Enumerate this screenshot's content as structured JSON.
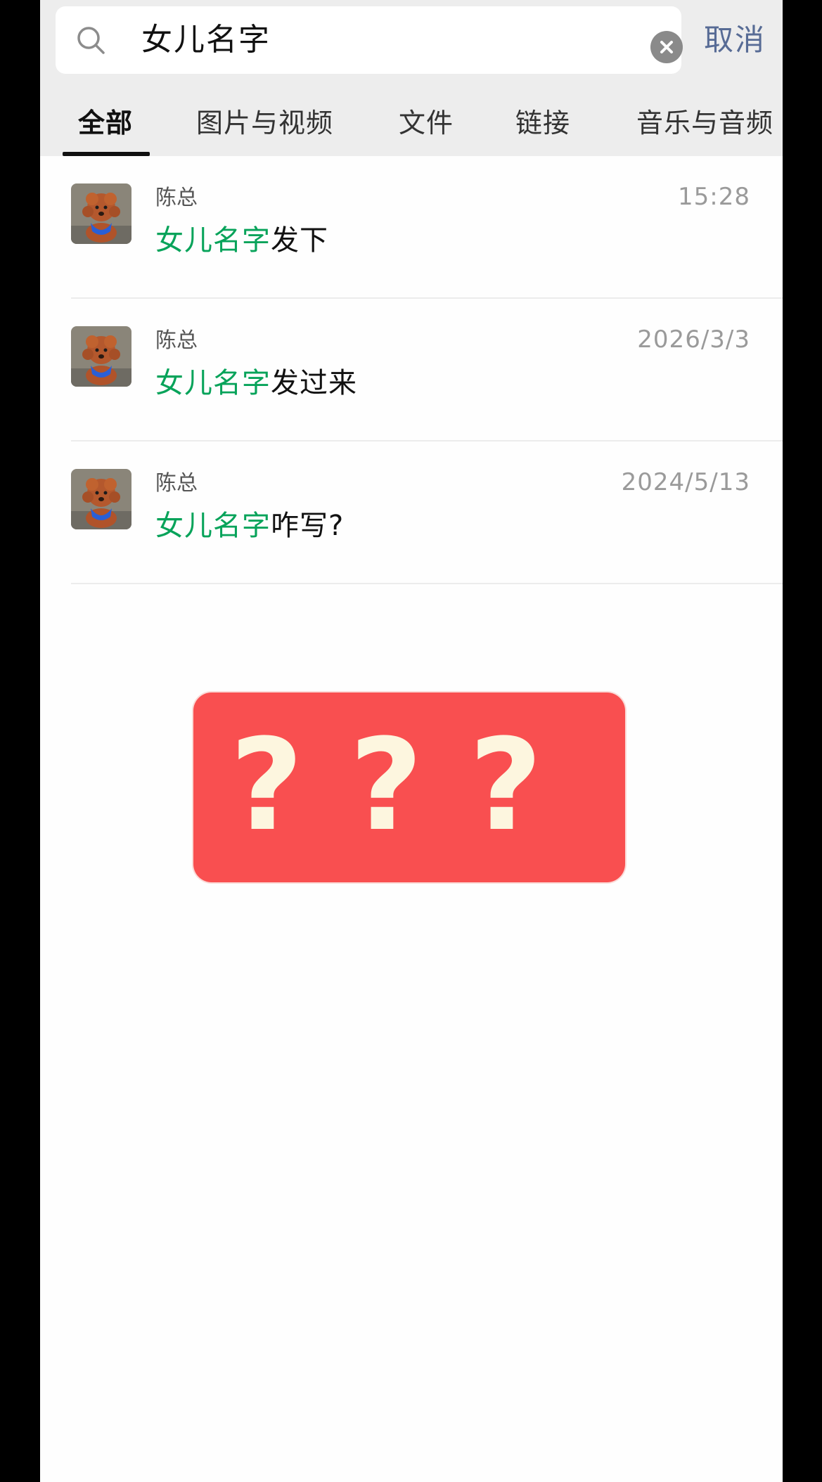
{
  "search": {
    "query": "女儿名字",
    "cancel_label": "取消"
  },
  "tabs": [
    {
      "label": "全部",
      "active": true
    },
    {
      "label": "图片与视频",
      "active": false
    },
    {
      "label": "文件",
      "active": false
    },
    {
      "label": "链接",
      "active": false
    },
    {
      "label": "音乐与音频",
      "active": false
    }
  ],
  "results": [
    {
      "sender": "陈总",
      "time": "15:28",
      "highlight": "女儿名字",
      "rest": "发下"
    },
    {
      "sender": "陈总",
      "time": "2026/3/3",
      "highlight": "女儿名字",
      "rest": "发过来"
    },
    {
      "sender": "陈总",
      "time": "2024/5/13",
      "highlight": "女儿名字",
      "rest": "咋写?"
    }
  ],
  "badge": {
    "marks": [
      "?",
      "?",
      "?"
    ]
  },
  "colors": {
    "highlight": "#07a35a",
    "cancel": "#576b95",
    "badge": "#f94f50"
  },
  "icons": {
    "search": "search-icon",
    "clear": "clear-icon",
    "avatar": "poodle-avatar"
  }
}
